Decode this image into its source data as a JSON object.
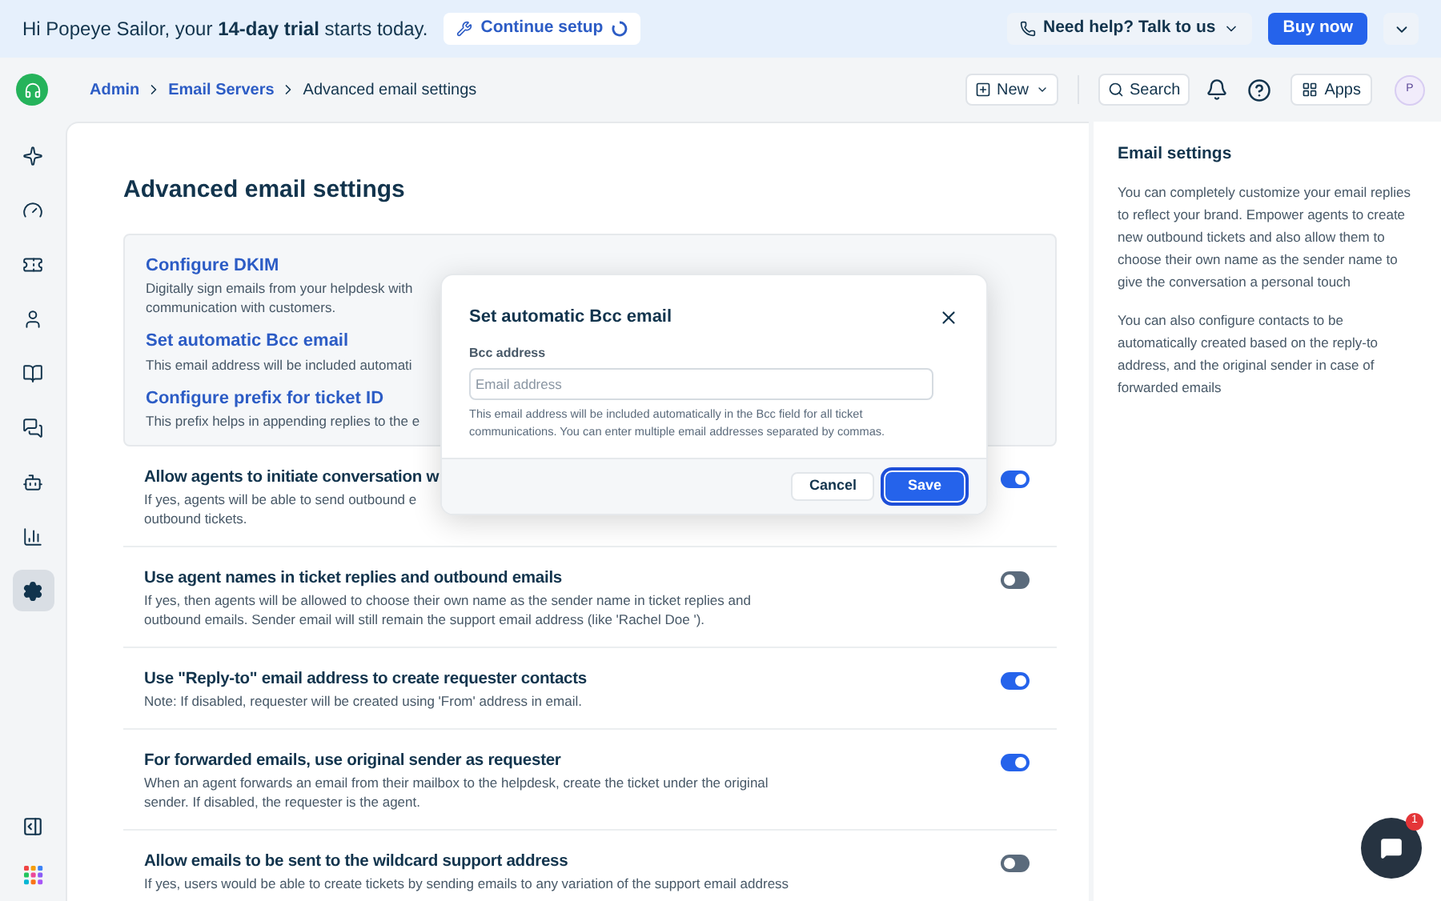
{
  "banner": {
    "greeting": "Hi Popeye Sailor, your **14-day trial** starts today.",
    "setup_button": "Continue setup",
    "help_button": "Need help? Talk to us",
    "buy_button": "Buy now"
  },
  "header": {
    "breadcrumbs": [
      "Admin",
      "Email Servers",
      "Advanced email settings"
    ],
    "new_button": "New",
    "search_button": "Search",
    "apps_button": "Apps",
    "avatar": "P"
  },
  "sidebar": {
    "items": [
      {
        "selected": false
      },
      {
        "selected": false
      },
      {
        "selected": false
      },
      {
        "selected": false
      },
      {
        "selected": false
      },
      {
        "selected": false
      },
      {
        "selected": false
      },
      {
        "selected": false
      },
      {
        "selected": true
      }
    ]
  },
  "page_title": "Advanced email settings",
  "links": [
    {
      "title": "Configure DKIM",
      "lines": [
        "Digitally sign emails from your helpdesk with",
        "communication with customers."
      ]
    },
    {
      "title": "Set automatic Bcc email",
      "lines": [
        "This email address will be included automati"
      ]
    },
    {
      "title": "Configure prefix for ticket ID",
      "lines": [
        "This prefix helps in appending replies to the e"
      ]
    }
  ],
  "settings": [
    {
      "title": "Allow agents to initiate conversation w",
      "lines": [
        "If yes, agents will be able to send outbound e",
        "outbound tickets."
      ],
      "on": true
    },
    {
      "title": "Use agent names in ticket replies and outbound emails",
      "lines": [
        "If yes, then agents will be allowed to choose their own name as the sender name in ticket replies and",
        "outbound emails. Sender email will still remain the support email address (like 'Rachel Doe ')."
      ],
      "on": false
    },
    {
      "title": "Use \"Reply-to\" email address to create requester contacts",
      "lines": [
        "Note: If disabled, requester will be created using 'From' address in email."
      ],
      "on": true
    },
    {
      "title": "For forwarded emails, use original sender as requester",
      "lines": [
        "When an agent forwards an email from their mailbox to the helpdesk, create the ticket under the original",
        "sender. If disabled, the requester is the agent."
      ],
      "on": true
    },
    {
      "title": "Allow emails to be sent to the wildcard support address",
      "lines": [
        "If yes, users would be able to create tickets by sending emails to any variation of the support email address"
      ],
      "on": false
    }
  ],
  "dialog": {
    "title": "Set automatic Bcc email",
    "field_label": "Bcc address",
    "placeholder": "Email address",
    "help": "This email address will be included automatically in the Bcc field for all ticket communications. You can enter multiple email addresses separated by commas.",
    "cancel": "Cancel",
    "save": "Save"
  },
  "side_panel": {
    "title": "Email settings",
    "paragraphs": [
      "You can completely customize your email replies to reflect your brand. Empower agents to create new outbound tickets and also allow them to choose their own name as the sender name to give the conversation a personal touch",
      "You can also configure contacts to be automatically created based on the reply-to address, and the original sender in case of forwarded emails"
    ]
  },
  "chat": {
    "badge": "1"
  }
}
